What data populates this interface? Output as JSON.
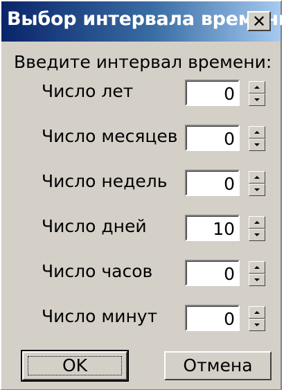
{
  "window": {
    "title": "Выбор интервала времени",
    "close_glyph": "✕"
  },
  "prompt": "Введите интервал времени:",
  "fields": [
    {
      "label": "Число лет",
      "value": "0"
    },
    {
      "label": "Число месяцев",
      "value": "0"
    },
    {
      "label": "Число недель",
      "value": "0"
    },
    {
      "label": "Число дней",
      "value": "10"
    },
    {
      "label": "Число часов",
      "value": "0"
    },
    {
      "label": "Число минут",
      "value": "0"
    }
  ],
  "buttons": {
    "ok_label": "OK",
    "cancel_label": "Отмена"
  },
  "icons": {
    "close": "close-icon",
    "spin_up": "spin-up-arrow-icon",
    "spin_down": "spin-down-arrow-icon"
  },
  "colors": {
    "titlebar_start": "#0a246a",
    "titlebar_end": "#a6caf0",
    "dialog_bg": "#d4d0c8"
  }
}
